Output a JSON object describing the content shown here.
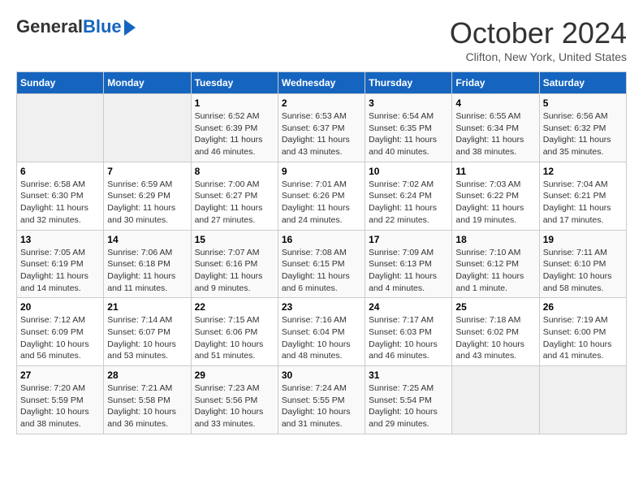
{
  "logo": {
    "general": "General",
    "blue": "Blue"
  },
  "title": "October 2024",
  "location": "Clifton, New York, United States",
  "days_of_week": [
    "Sunday",
    "Monday",
    "Tuesday",
    "Wednesday",
    "Thursday",
    "Friday",
    "Saturday"
  ],
  "weeks": [
    [
      {
        "day": "",
        "sunrise": "",
        "sunset": "",
        "daylight": "",
        "empty": true
      },
      {
        "day": "",
        "sunrise": "",
        "sunset": "",
        "daylight": "",
        "empty": true
      },
      {
        "day": "1",
        "sunrise": "Sunrise: 6:52 AM",
        "sunset": "Sunset: 6:39 PM",
        "daylight": "Daylight: 11 hours and 46 minutes."
      },
      {
        "day": "2",
        "sunrise": "Sunrise: 6:53 AM",
        "sunset": "Sunset: 6:37 PM",
        "daylight": "Daylight: 11 hours and 43 minutes."
      },
      {
        "day": "3",
        "sunrise": "Sunrise: 6:54 AM",
        "sunset": "Sunset: 6:35 PM",
        "daylight": "Daylight: 11 hours and 40 minutes."
      },
      {
        "day": "4",
        "sunrise": "Sunrise: 6:55 AM",
        "sunset": "Sunset: 6:34 PM",
        "daylight": "Daylight: 11 hours and 38 minutes."
      },
      {
        "day": "5",
        "sunrise": "Sunrise: 6:56 AM",
        "sunset": "Sunset: 6:32 PM",
        "daylight": "Daylight: 11 hours and 35 minutes."
      }
    ],
    [
      {
        "day": "6",
        "sunrise": "Sunrise: 6:58 AM",
        "sunset": "Sunset: 6:30 PM",
        "daylight": "Daylight: 11 hours and 32 minutes."
      },
      {
        "day": "7",
        "sunrise": "Sunrise: 6:59 AM",
        "sunset": "Sunset: 6:29 PM",
        "daylight": "Daylight: 11 hours and 30 minutes."
      },
      {
        "day": "8",
        "sunrise": "Sunrise: 7:00 AM",
        "sunset": "Sunset: 6:27 PM",
        "daylight": "Daylight: 11 hours and 27 minutes."
      },
      {
        "day": "9",
        "sunrise": "Sunrise: 7:01 AM",
        "sunset": "Sunset: 6:26 PM",
        "daylight": "Daylight: 11 hours and 24 minutes."
      },
      {
        "day": "10",
        "sunrise": "Sunrise: 7:02 AM",
        "sunset": "Sunset: 6:24 PM",
        "daylight": "Daylight: 11 hours and 22 minutes."
      },
      {
        "day": "11",
        "sunrise": "Sunrise: 7:03 AM",
        "sunset": "Sunset: 6:22 PM",
        "daylight": "Daylight: 11 hours and 19 minutes."
      },
      {
        "day": "12",
        "sunrise": "Sunrise: 7:04 AM",
        "sunset": "Sunset: 6:21 PM",
        "daylight": "Daylight: 11 hours and 17 minutes."
      }
    ],
    [
      {
        "day": "13",
        "sunrise": "Sunrise: 7:05 AM",
        "sunset": "Sunset: 6:19 PM",
        "daylight": "Daylight: 11 hours and 14 minutes."
      },
      {
        "day": "14",
        "sunrise": "Sunrise: 7:06 AM",
        "sunset": "Sunset: 6:18 PM",
        "daylight": "Daylight: 11 hours and 11 minutes."
      },
      {
        "day": "15",
        "sunrise": "Sunrise: 7:07 AM",
        "sunset": "Sunset: 6:16 PM",
        "daylight": "Daylight: 11 hours and 9 minutes."
      },
      {
        "day": "16",
        "sunrise": "Sunrise: 7:08 AM",
        "sunset": "Sunset: 6:15 PM",
        "daylight": "Daylight: 11 hours and 6 minutes."
      },
      {
        "day": "17",
        "sunrise": "Sunrise: 7:09 AM",
        "sunset": "Sunset: 6:13 PM",
        "daylight": "Daylight: 11 hours and 4 minutes."
      },
      {
        "day": "18",
        "sunrise": "Sunrise: 7:10 AM",
        "sunset": "Sunset: 6:12 PM",
        "daylight": "Daylight: 11 hours and 1 minute."
      },
      {
        "day": "19",
        "sunrise": "Sunrise: 7:11 AM",
        "sunset": "Sunset: 6:10 PM",
        "daylight": "Daylight: 10 hours and 58 minutes."
      }
    ],
    [
      {
        "day": "20",
        "sunrise": "Sunrise: 7:12 AM",
        "sunset": "Sunset: 6:09 PM",
        "daylight": "Daylight: 10 hours and 56 minutes."
      },
      {
        "day": "21",
        "sunrise": "Sunrise: 7:14 AM",
        "sunset": "Sunset: 6:07 PM",
        "daylight": "Daylight: 10 hours and 53 minutes."
      },
      {
        "day": "22",
        "sunrise": "Sunrise: 7:15 AM",
        "sunset": "Sunset: 6:06 PM",
        "daylight": "Daylight: 10 hours and 51 minutes."
      },
      {
        "day": "23",
        "sunrise": "Sunrise: 7:16 AM",
        "sunset": "Sunset: 6:04 PM",
        "daylight": "Daylight: 10 hours and 48 minutes."
      },
      {
        "day": "24",
        "sunrise": "Sunrise: 7:17 AM",
        "sunset": "Sunset: 6:03 PM",
        "daylight": "Daylight: 10 hours and 46 minutes."
      },
      {
        "day": "25",
        "sunrise": "Sunrise: 7:18 AM",
        "sunset": "Sunset: 6:02 PM",
        "daylight": "Daylight: 10 hours and 43 minutes."
      },
      {
        "day": "26",
        "sunrise": "Sunrise: 7:19 AM",
        "sunset": "Sunset: 6:00 PM",
        "daylight": "Daylight: 10 hours and 41 minutes."
      }
    ],
    [
      {
        "day": "27",
        "sunrise": "Sunrise: 7:20 AM",
        "sunset": "Sunset: 5:59 PM",
        "daylight": "Daylight: 10 hours and 38 minutes."
      },
      {
        "day": "28",
        "sunrise": "Sunrise: 7:21 AM",
        "sunset": "Sunset: 5:58 PM",
        "daylight": "Daylight: 10 hours and 36 minutes."
      },
      {
        "day": "29",
        "sunrise": "Sunrise: 7:23 AM",
        "sunset": "Sunset: 5:56 PM",
        "daylight": "Daylight: 10 hours and 33 minutes."
      },
      {
        "day": "30",
        "sunrise": "Sunrise: 7:24 AM",
        "sunset": "Sunset: 5:55 PM",
        "daylight": "Daylight: 10 hours and 31 minutes."
      },
      {
        "day": "31",
        "sunrise": "Sunrise: 7:25 AM",
        "sunset": "Sunset: 5:54 PM",
        "daylight": "Daylight: 10 hours and 29 minutes."
      },
      {
        "day": "",
        "sunrise": "",
        "sunset": "",
        "daylight": "",
        "empty": true
      },
      {
        "day": "",
        "sunrise": "",
        "sunset": "",
        "daylight": "",
        "empty": true
      }
    ]
  ]
}
